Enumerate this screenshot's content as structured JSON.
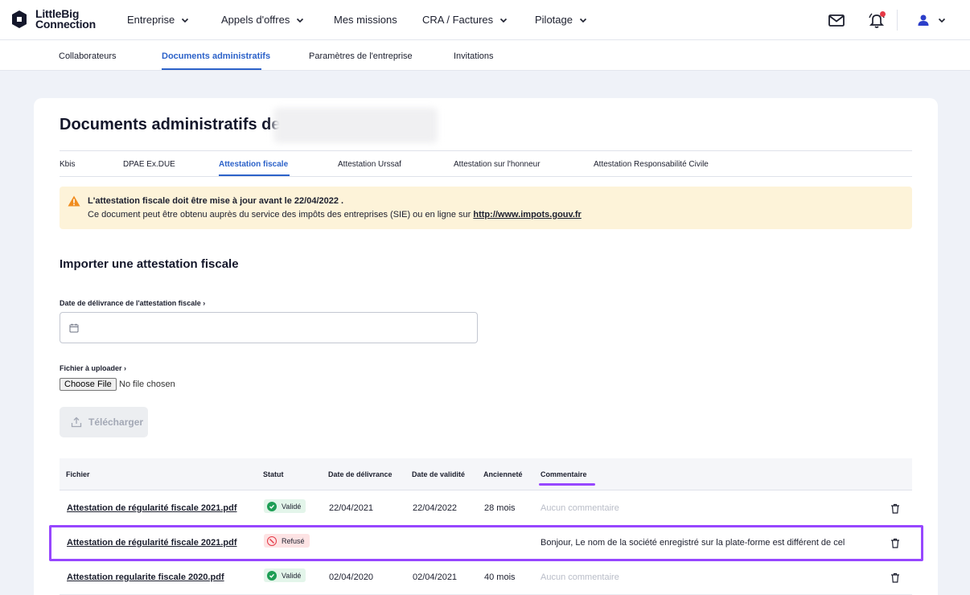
{
  "brand": {
    "line1": "LittleBig",
    "line2": "Connection"
  },
  "nav": {
    "items": [
      {
        "label": "Entreprise",
        "dropdown": true
      },
      {
        "label": "Appels d'offres",
        "dropdown": true
      },
      {
        "label": "Mes missions",
        "dropdown": false
      },
      {
        "label": "CRA / Factures",
        "dropdown": true
      },
      {
        "label": "Pilotage",
        "dropdown": true
      }
    ],
    "icons": [
      "mail-icon",
      "bell-icon",
      "user-icon"
    ]
  },
  "subnav": {
    "items": [
      "Collaborateurs",
      "Documents administratifs",
      "Paramètres de l'entreprise",
      "Invitations"
    ],
    "active": "Documents administratifs"
  },
  "page": {
    "title": "Documents administratifs de",
    "tabs": [
      "Kbis",
      "DPAE Ex.DUE",
      "Attestation fiscale",
      "Attestation Urssaf",
      "Attestation sur l'honneur",
      "Attestation Responsabilité Civile"
    ],
    "active_tab": "Attestation fiscale"
  },
  "alert": {
    "title": "L'attestation fiscale doit être mise à jour avant le 22/04/2022 .",
    "text": "Ce document peut être obtenu auprès du service des impôts des entreprises (SIE) ou en ligne sur",
    "link": "http://www.impots.gouv.fr"
  },
  "form": {
    "section_title": "Importer une attestation fiscale",
    "date_label": "Date de délivrance de l'attestation fiscale",
    "date_value": "",
    "file_label": "Fichier à uploader",
    "file_button": "Choose File",
    "file_status": "No file chosen",
    "upload_button": "Télécharger"
  },
  "table": {
    "headers": [
      "Fichier",
      "Statut",
      "Date de délivrance",
      "Date de validité",
      "Ancienneté",
      "Commentaire"
    ],
    "rows": [
      {
        "file": "Attestation de régularité fiscale 2021.pdf",
        "status": "Validé",
        "issued": "22/04/2021",
        "valid": "22/04/2022",
        "age": "28 mois",
        "comment": "Aucun commentaire"
      },
      {
        "file": "Attestation de régularité fiscale 2021.pdf",
        "status": "Refusé",
        "issued": "",
        "valid": "",
        "age": "",
        "comment": "Bonjour, Le nom de la société enregistré sur la plate-forme est différent de cel"
      },
      {
        "file": "Attestation regularite fiscale 2020.pdf",
        "status": "Validé",
        "issued": "02/04/2020",
        "valid": "02/04/2021",
        "age": "40 mois",
        "comment": "Aucun commentaire"
      }
    ]
  },
  "colors": {
    "accent": "#2c62c9",
    "highlight": "#9747ff",
    "success": "#1e9e55",
    "danger": "#e53946",
    "warning_bg": "#fdf3d9"
  }
}
